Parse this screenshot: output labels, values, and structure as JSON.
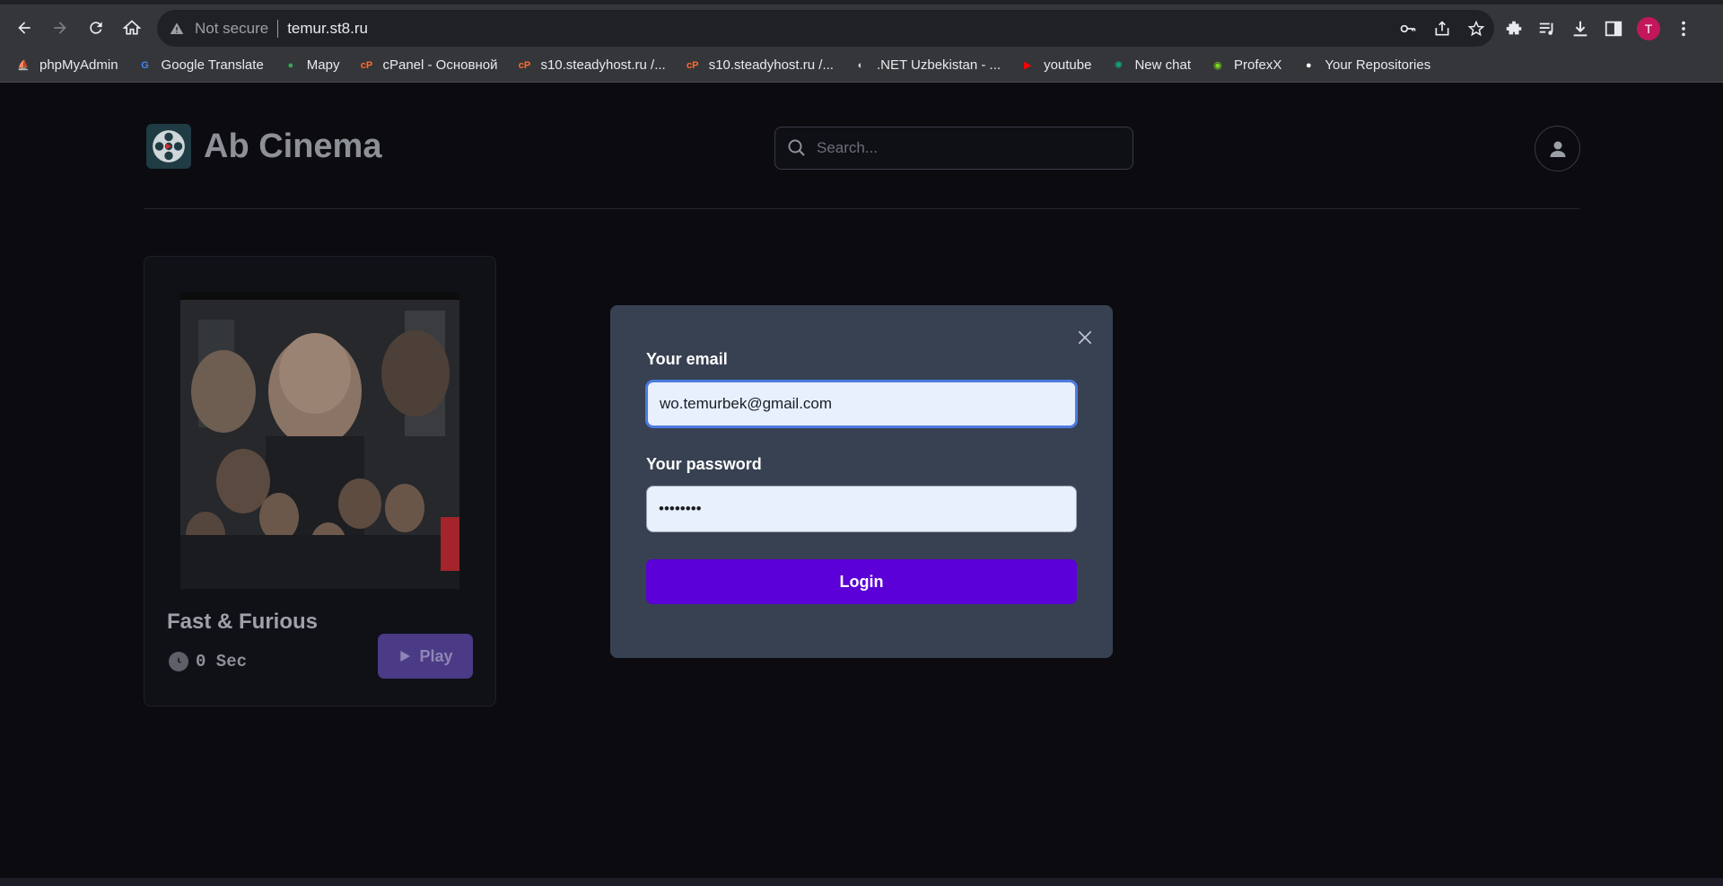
{
  "browser": {
    "address": {
      "security_text": "Not secure",
      "url": "temur.st8.ru"
    },
    "profile_initial": "T",
    "bookmarks": [
      {
        "label": "phpMyAdmin",
        "icon": "phpmyadmin-icon",
        "color": "#f89c0e"
      },
      {
        "label": "Google Translate",
        "icon": "google-translate-icon",
        "color": "#4285f4"
      },
      {
        "label": "Mapy",
        "icon": "maps-pin-icon",
        "color": "#34a853"
      },
      {
        "label": "cPanel - Основной",
        "icon": "cpanel-icon",
        "color": "#ff6c2c"
      },
      {
        "label": "s10.steadyhost.ru /...",
        "icon": "cpanel-icon",
        "color": "#ff6c2c"
      },
      {
        "label": "s10.steadyhost.ru /...",
        "icon": "cpanel-icon",
        "color": "#ff6c2c"
      },
      {
        "label": ".NET Uzbekistan - ...",
        "icon": "dotnet-uz-icon",
        "color": "#d9d9d9"
      },
      {
        "label": "youtube",
        "icon": "youtube-icon",
        "color": "#ff0000"
      },
      {
        "label": "New chat",
        "icon": "chatgpt-icon",
        "color": "#10a37f"
      },
      {
        "label": "ProfexX",
        "icon": "profexx-icon",
        "color": "#7ed321"
      },
      {
        "label": "Your Repositories",
        "icon": "github-icon",
        "color": "#ffffff"
      }
    ]
  },
  "site": {
    "brand": "Ab Cinema",
    "search": {
      "placeholder": "Search..."
    }
  },
  "movie": {
    "title": "Fast & Furious",
    "duration": "0 Sec",
    "play_label": "Play"
  },
  "login_modal": {
    "email_label": "Your email",
    "email_value": "wo.temurbek@gmail.com",
    "password_label": "Your password",
    "password_value": "••••••••",
    "submit_label": "Login"
  },
  "colors": {
    "accent": "#5b00d6",
    "modal_bg": "#384152",
    "page_bg": "#0b0b10"
  }
}
